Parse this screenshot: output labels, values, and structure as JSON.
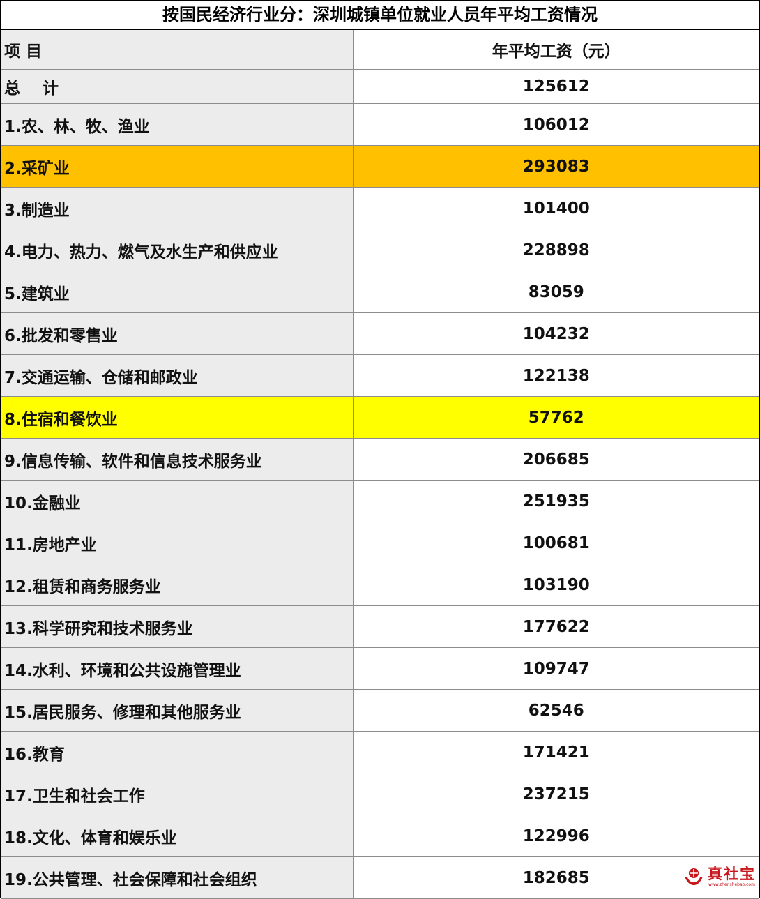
{
  "title": "按国民经济行业分：深圳城镇单位就业人员年平均工资情况",
  "header": {
    "col1": "项 目",
    "col2": "年平均工资（元）"
  },
  "rows": [
    {
      "name": "总    计",
      "value": "125612"
    },
    {
      "name": "1.农、林、牧、渔业",
      "value": "106012"
    },
    {
      "name": "2.采矿业",
      "value": "293083"
    },
    {
      "name": "3.制造业",
      "value": "101400"
    },
    {
      "name": "4.电力、热力、燃气及水生产和供应业",
      "value": "228898"
    },
    {
      "name": "5.建筑业",
      "value": "83059"
    },
    {
      "name": "6.批发和零售业",
      "value": "104232"
    },
    {
      "name": "7.交通运输、仓储和邮政业",
      "value": "122138"
    },
    {
      "name": "8.住宿和餐饮业",
      "value": "57762"
    },
    {
      "name": "9.信息传输、软件和信息技术服务业",
      "value": "206685"
    },
    {
      "name": "10.金融业",
      "value": "251935"
    },
    {
      "name": "11.房地产业",
      "value": "100681"
    },
    {
      "name": "12.租赁和商务服务业",
      "value": "103190"
    },
    {
      "name": "13.科学研究和技术服务业",
      "value": "177622"
    },
    {
      "name": "14.水利、环境和公共设施管理业",
      "value": "109747"
    },
    {
      "name": "15.居民服务、修理和其他服务业",
      "value": "62546"
    },
    {
      "name": "16.教育",
      "value": "171421"
    },
    {
      "name": "17.卫生和社会工作",
      "value": "237215"
    },
    {
      "name": "18.文化、体育和娱乐业",
      "value": "122996"
    },
    {
      "name": "19.公共管理、社会保障和社会组织",
      "value": "182685"
    }
  ],
  "highlights": {
    "orange": "#ffc000",
    "yellow": "#ffff00"
  },
  "watermark": {
    "text": "真社宝",
    "sub": "www.zhenshebao.com",
    "icon": "hands-logo-icon",
    "color": "#c8161d"
  }
}
